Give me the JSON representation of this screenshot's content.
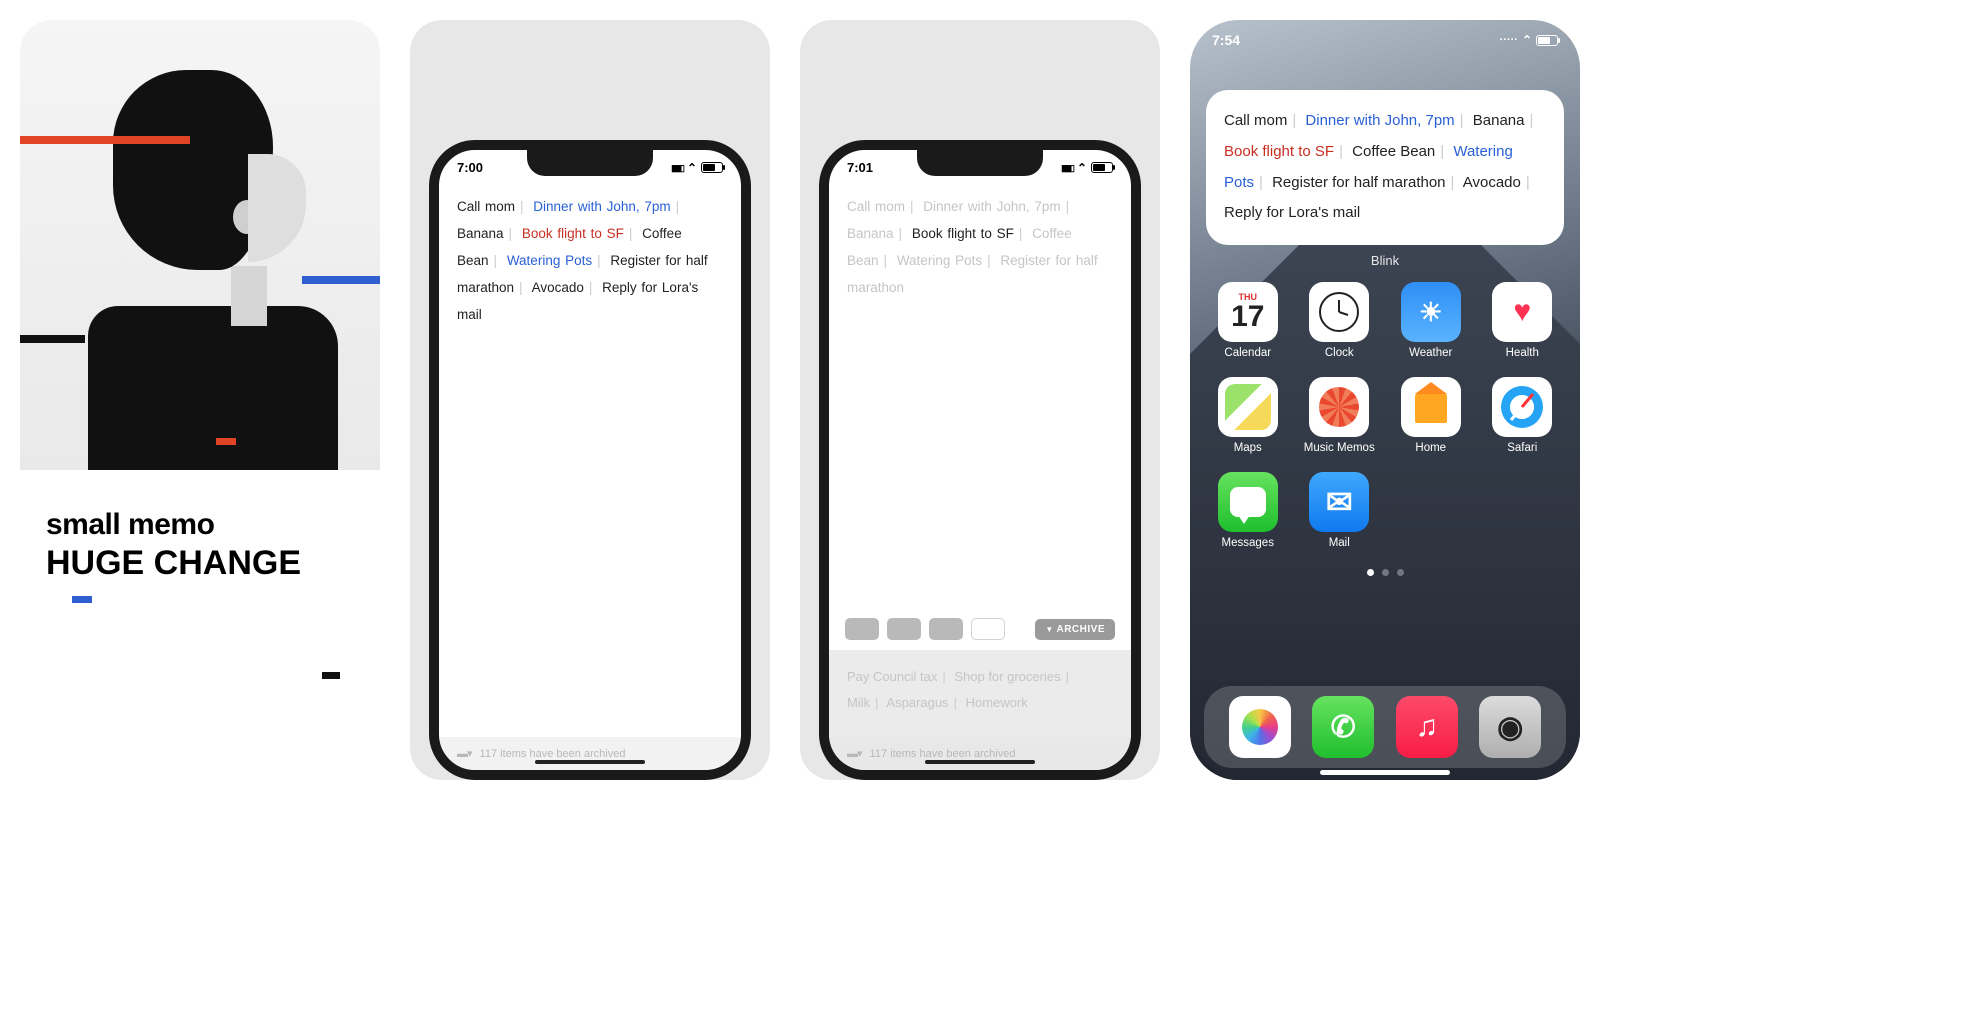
{
  "promo": {
    "line1": "small memo",
    "line2": "HUGE CHANGE"
  },
  "panel2": {
    "time": "7:00",
    "items": [
      {
        "text": "Call mom",
        "color": "black"
      },
      {
        "text": "Dinner with John, 7pm",
        "color": "blue"
      },
      {
        "text": "Banana",
        "color": "black"
      },
      {
        "text": "Book flight to SF",
        "color": "red"
      },
      {
        "text": "Coffee Bean",
        "color": "black"
      },
      {
        "text": "Watering Pots",
        "color": "blue"
      },
      {
        "text": "Register for half marathon",
        "color": "black"
      },
      {
        "text": "Avocado",
        "color": "black"
      },
      {
        "text": "Reply for Lora's mail",
        "color": "black"
      }
    ],
    "archive_footer": "117 items have been archived"
  },
  "panel3": {
    "time": "7:01",
    "items_top": [
      {
        "text": "Call mom",
        "faded": true
      },
      {
        "text": "Dinner with John, 7pm",
        "faded": true
      },
      {
        "text": "Banana",
        "faded": true
      },
      {
        "text": "Book flight to SF",
        "faded": false,
        "bold": true
      },
      {
        "text": "Coffee Bean",
        "faded": true
      },
      {
        "text": "Watering Pots",
        "faded": true
      },
      {
        "text": "Register for half marathon",
        "faded": true
      }
    ],
    "archive_label": "ARCHIVE",
    "items_archived": [
      "Pay Council tax",
      "Shop for groceries",
      "Milk",
      "Asparagus",
      "Homework"
    ],
    "archive_footer": "117 items have been archived"
  },
  "panel4": {
    "time": "7:54",
    "widget_name": "Blink",
    "widget_items": [
      {
        "text": "Call mom",
        "color": "black"
      },
      {
        "text": "Dinner with John, 7pm",
        "color": "blue"
      },
      {
        "text": "Banana",
        "color": "black"
      },
      {
        "text": "Book flight to SF",
        "color": "red"
      },
      {
        "text": "Coffee Bean",
        "color": "black"
      },
      {
        "text": "Watering Pots",
        "color": "blue"
      },
      {
        "text": "Register for half marathon",
        "color": "black"
      },
      {
        "text": "Avocado",
        "color": "black"
      },
      {
        "text": "Reply for Lora's mail",
        "color": "black"
      }
    ],
    "calendar": {
      "dow": "THU",
      "day": "17"
    },
    "apps_row1": [
      "Calendar",
      "Clock",
      "Weather",
      "Health"
    ],
    "apps_row2": [
      "Maps",
      "Music Memos",
      "Home",
      "Safari"
    ],
    "apps_row3": [
      "Messages",
      "Mail"
    ],
    "dock": [
      "Photos",
      "Phone",
      "Music",
      "Camera"
    ]
  }
}
